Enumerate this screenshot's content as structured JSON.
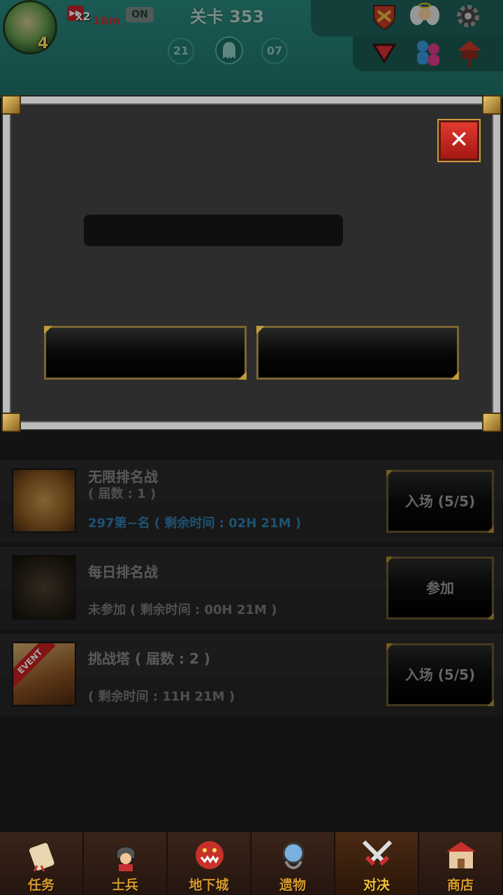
{
  "top_bar": {
    "level": "4",
    "speed_multiplier": "x2",
    "speed_time": "16m",
    "auto_toggle": "ON",
    "stage_title": "关卡 353",
    "wave_left": "21",
    "wave_right": "07"
  },
  "list": {
    "rows": [
      {
        "title": "无限排名战",
        "subtitle": "( 届数 : 1 )",
        "status": "297第~名 ( 剩余时间 : 02H 21M )",
        "button": "入场 (5/5)"
      },
      {
        "title": "每日排名战",
        "status": "未参加 ( 剩余时间 : 00H 21M )",
        "button": "参加"
      },
      {
        "title": "挑战塔 ( 届数 : 2 )",
        "status": "( 剩余时间 : 11H 21M )",
        "button": "入场 (5/5)",
        "badge": "EVENT"
      }
    ]
  },
  "modal": {
    "title": "",
    "input_value": "",
    "button_left": "",
    "button_right": "",
    "close_symbol": "✕"
  },
  "nav": {
    "items": [
      {
        "label": "任务",
        "icon": "scroll-icon"
      },
      {
        "label": "士兵",
        "icon": "soldier-icon"
      },
      {
        "label": "地下城",
        "icon": "dungeon-icon"
      },
      {
        "label": "遗物",
        "icon": "relic-icon"
      },
      {
        "label": "对决",
        "icon": "swords-icon",
        "active": true
      },
      {
        "label": "商店",
        "icon": "shop-icon"
      }
    ]
  }
}
